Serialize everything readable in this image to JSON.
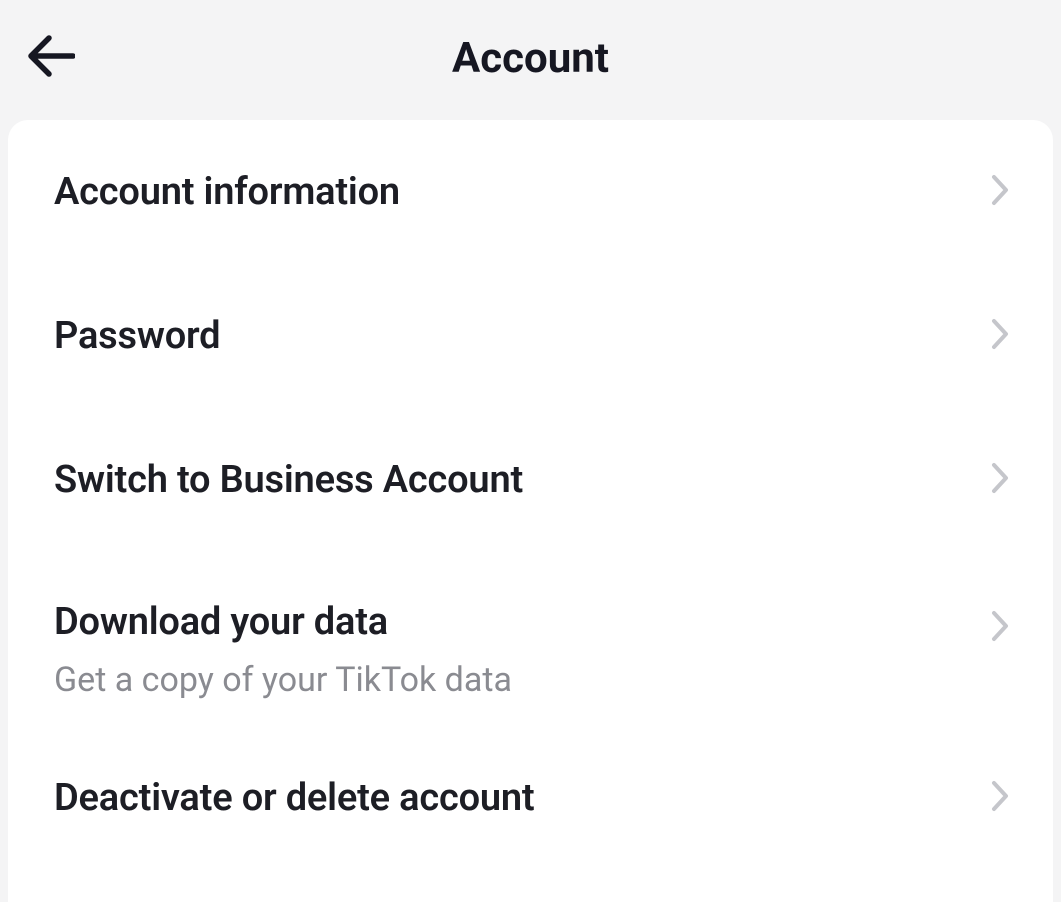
{
  "header": {
    "title": "Account"
  },
  "items": [
    {
      "label": "Account information",
      "sublabel": null
    },
    {
      "label": "Password",
      "sublabel": null
    },
    {
      "label": "Switch to Business Account",
      "sublabel": null
    },
    {
      "label": "Download your data",
      "sublabel": "Get a copy of your TikTok data"
    },
    {
      "label": "Deactivate or delete account",
      "sublabel": null
    }
  ]
}
